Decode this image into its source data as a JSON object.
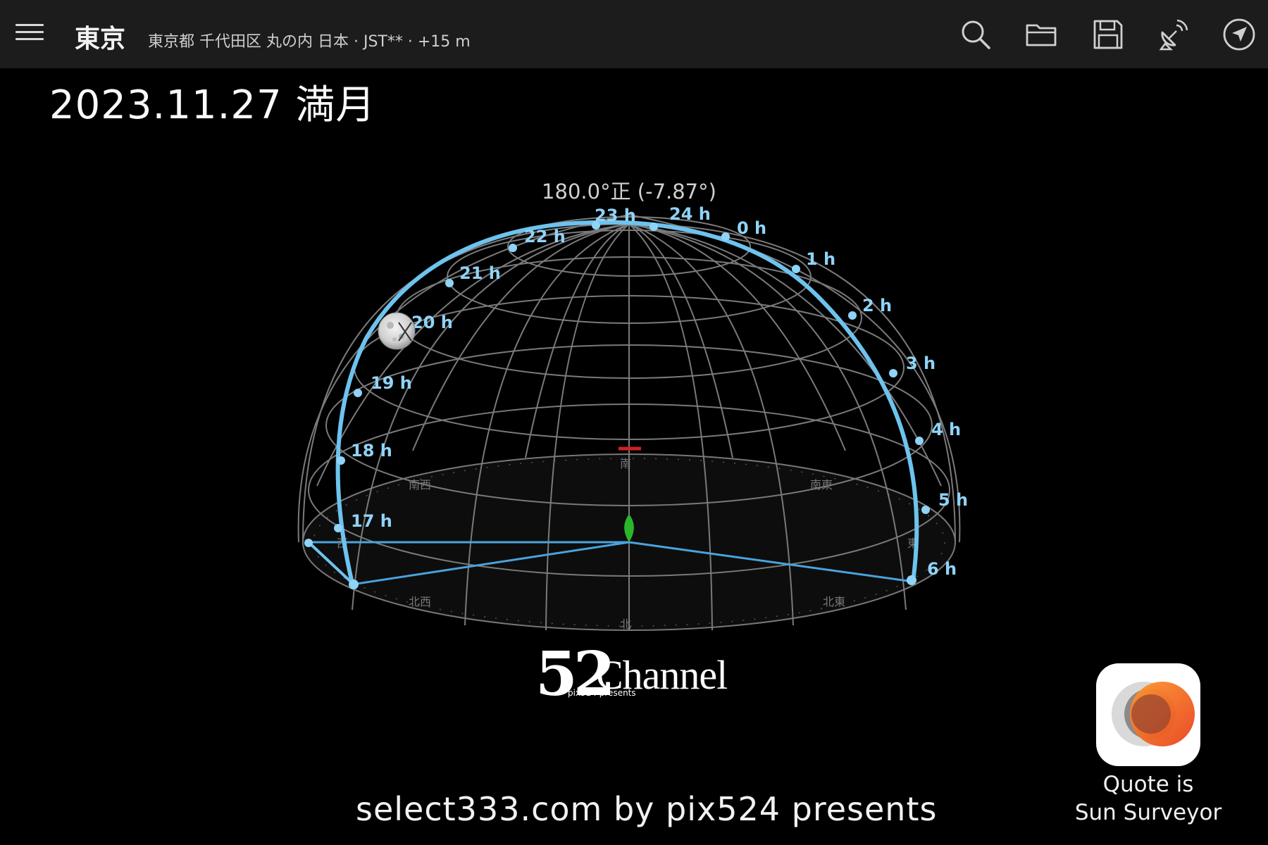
{
  "header": {
    "city": "東京",
    "location_detail": "東京都 千代田区 丸の内 日本 · JST** · +15 m",
    "icons": [
      "menu-icon",
      "search-icon",
      "folder-icon",
      "save-icon",
      "satellite-dish-icon",
      "navigation-arrow-icon"
    ]
  },
  "title": "2023.11.27 満月",
  "sphere": {
    "top_readout": "180.0°正 (-7.87°)",
    "hour_labels": [
      "23 h",
      "24 h",
      "0 h",
      "1 h",
      "2 h",
      "3 h",
      "4 h",
      "5 h",
      "6 h",
      "22 h",
      "21 h",
      "20 h",
      "19 h",
      "18 h",
      "17 h"
    ],
    "cardinals": {
      "south": "南",
      "north": "北",
      "east": "東",
      "west": "西",
      "southeast": "南東",
      "southwest": "南西",
      "northeast": "北東",
      "northwest": "北西"
    },
    "colors": {
      "path": "#6ec3ee",
      "grid": "#7a7a7a",
      "sun_marker": "#2bb52b",
      "south_marker": "#cc2222"
    },
    "moon_icon": "full-moon-icon"
  },
  "watermark": {
    "logo_number": "52",
    "logo_word": "Channel",
    "logo_sub": "pix524 presents"
  },
  "credit": "select333.com by pix524 presents",
  "app_badge": {
    "line1": "Quote is",
    "line2": "Sun Surveyor",
    "icon": "sun-surveyor-app-icon"
  }
}
